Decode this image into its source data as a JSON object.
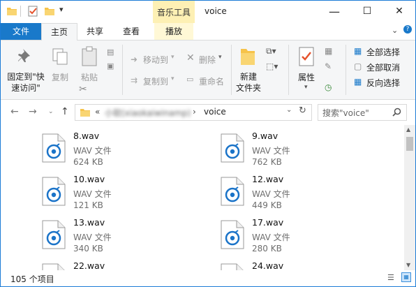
{
  "title_bar": {
    "context_tab": "音乐工具",
    "window_title": "voice",
    "minimize": "—",
    "maximize": "☐",
    "close": "✕"
  },
  "tabs": {
    "file": "文件",
    "home": "主页",
    "share": "共享",
    "view": "查看",
    "play": "播放"
  },
  "ribbon": {
    "pin_line1": "固定到\"快",
    "pin_line2": "速访问\"",
    "copy": "复制",
    "paste": "粘贴",
    "move_to": "移动到",
    "delete": "删除",
    "copy_to": "复制到",
    "rename": "重命名",
    "new_folder_line1": "新建",
    "new_folder_line2": "文件夹",
    "properties": "属性",
    "select_all": "全部选择",
    "select_none": "全部取消",
    "invert_selection": "反向选择"
  },
  "address": {
    "prefix": "«",
    "blurred_segment": "小软(xiaokaiwinamp)",
    "current": "voice",
    "search_placeholder": "搜索\"voice\""
  },
  "files": [
    {
      "name": "8.wav",
      "type": "WAV 文件",
      "size": "624 KB"
    },
    {
      "name": "9.wav",
      "type": "WAV 文件",
      "size": "762 KB"
    },
    {
      "name": "10.wav",
      "type": "WAV 文件",
      "size": "121 KB"
    },
    {
      "name": "12.wav",
      "type": "WAV 文件",
      "size": "449 KB"
    },
    {
      "name": "13.wav",
      "type": "WAV 文件",
      "size": "340 KB"
    },
    {
      "name": "17.wav",
      "type": "WAV 文件",
      "size": "280 KB"
    },
    {
      "name": "22.wav",
      "type": "",
      "size": ""
    },
    {
      "name": "24.wav",
      "type": "",
      "size": ""
    }
  ],
  "status": {
    "item_count": "105 个项目"
  },
  "colors": {
    "accent": "#1979ca",
    "context_tab_bg": "#fdf0b4",
    "folder": "#f6c34a",
    "audio_icon": "#1a73c8"
  }
}
